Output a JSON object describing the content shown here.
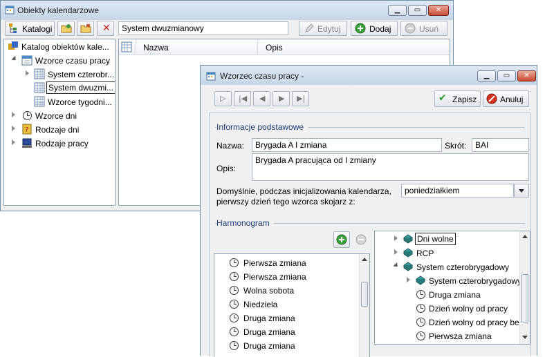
{
  "bg_window": {
    "title": "Obiekty kalendarzowe",
    "toolbar": {
      "katalogi_label": "Katalogi",
      "search_value": "System dwuzmianowy",
      "edit_label": "Edytuj",
      "add_label": "Dodaj",
      "delete_label": "Usuń"
    },
    "tree": {
      "root": "Katalog obiektów kale...",
      "items": [
        {
          "label": "Wzorce czasu pracy",
          "icon": "calendar-icon"
        },
        {
          "label": "System czterobr...",
          "icon": "grid-icon"
        },
        {
          "label": "System dwuzmi...",
          "icon": "grid-icon"
        },
        {
          "label": "Wzorce tygodni...",
          "icon": "grid-icon"
        },
        {
          "label": "Wzorce dni",
          "icon": "clock-icon"
        },
        {
          "label": "Rodzaje dni",
          "icon": "question-icon"
        },
        {
          "label": "Rodzaje pracy",
          "icon": "computer-icon"
        }
      ]
    },
    "list_headers": {
      "name": "Nazwa",
      "desc": "Opis"
    }
  },
  "dialog": {
    "title": "Wzorzec czasu pracy -",
    "save_label": "Zapisz",
    "cancel_label": "Anuluj",
    "section_basic": "Informacje podstawowe",
    "name_label": "Nazwa:",
    "name_value": "Brygada A I zmiana",
    "short_label": "Skrót:",
    "short_value": "BAI",
    "desc_label": "Opis:",
    "desc_value": "Brygada A pracująca od I zmiany",
    "default_label_1": "Domyślnie, podczas inicjalizowania kalendarza,",
    "default_label_2": "pierwszy dzień tego wzorca skojarz z:",
    "default_value": "poniedziałkiem",
    "section_harmonogram": "Harmonogram",
    "left_list": [
      "Pierwsza zmiana",
      "Pierwsza zmiana",
      "Wolna sobota",
      "Niedziela",
      "Druga zmiana",
      "Druga zmiana",
      "Druga zmiana"
    ],
    "right_tree": [
      {
        "label": "Dni wolne",
        "level": 0,
        "icon": "books-icon"
      },
      {
        "label": "RCP",
        "level": 0,
        "icon": "books-icon"
      },
      {
        "label": "System czterobrygadowy",
        "level": 0,
        "icon": "books-icon"
      },
      {
        "label": "System czterobrygadowy",
        "level": 1,
        "icon": "books-icon"
      },
      {
        "label": "Druga zmiana",
        "level": 2,
        "icon": "clock-icon"
      },
      {
        "label": "Dzień wolny od pracy",
        "level": 2,
        "icon": "clock-icon"
      },
      {
        "label": "Dzień wolny od pracy bez",
        "level": 2,
        "icon": "clock-icon"
      },
      {
        "label": "Pierwsza zmiana",
        "level": 2,
        "icon": "clock-icon"
      }
    ]
  }
}
